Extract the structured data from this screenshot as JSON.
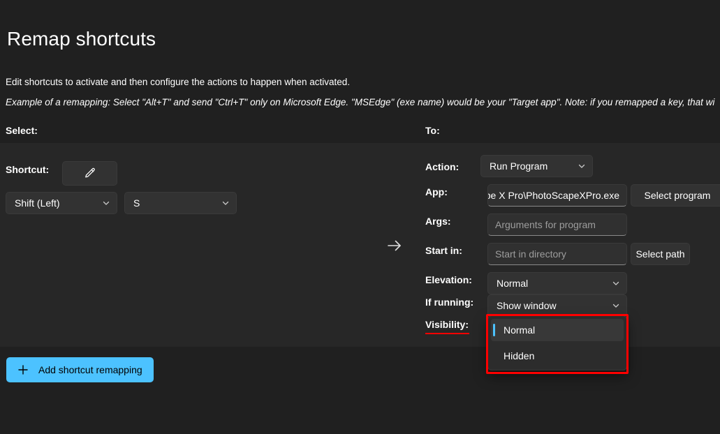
{
  "page": {
    "title": "Remap shortcuts",
    "description_line1": "Edit shortcuts to activate and then configure the actions to happen when activated.",
    "description_line2": "Example of a remapping: Select \"Alt+T\" and send \"Ctrl+T\" only on Microsoft Edge. \"MSEdge\" (exe name) would be your \"Target app\". Note: if you remapped a key, that wi"
  },
  "columns": {
    "select_header": "Select:",
    "to_header": "To:"
  },
  "source": {
    "shortcut_label": "Shortcut:",
    "edit_icon": "pencil-icon",
    "modifier_value": "Shift (Left)",
    "key_value": "S"
  },
  "arrow_icon": "arrow-right-icon",
  "target": {
    "action_label": "Action:",
    "action_value": "Run Program",
    "app_label": "App:",
    "app_value": "pe X Pro\\PhotoScapeXPro.exe",
    "select_program_label": "Select program",
    "args_label": "Args:",
    "args_placeholder": "Arguments for program",
    "args_value": "",
    "start_in_label": "Start in:",
    "start_in_placeholder": "Start in directory",
    "start_in_value": "",
    "select_path_label": "Select path",
    "elevation_label": "Elevation:",
    "elevation_value": "Normal",
    "if_running_label": "If running:",
    "if_running_value": "Show window",
    "visibility_label": "Visibility:"
  },
  "visibility_dropdown": {
    "open": true,
    "selected": "Normal",
    "options": [
      {
        "label": "Normal",
        "selected": true
      },
      {
        "label": "Hidden",
        "selected": false
      }
    ]
  },
  "footer": {
    "add_button_label": "Add shortcut remapping",
    "add_icon": "plus-icon"
  },
  "colors": {
    "page_background": "#202020",
    "card_background": "#272727",
    "accent": "#4cc2ff",
    "annotation": "#ff0000",
    "control_background": "#323232"
  }
}
